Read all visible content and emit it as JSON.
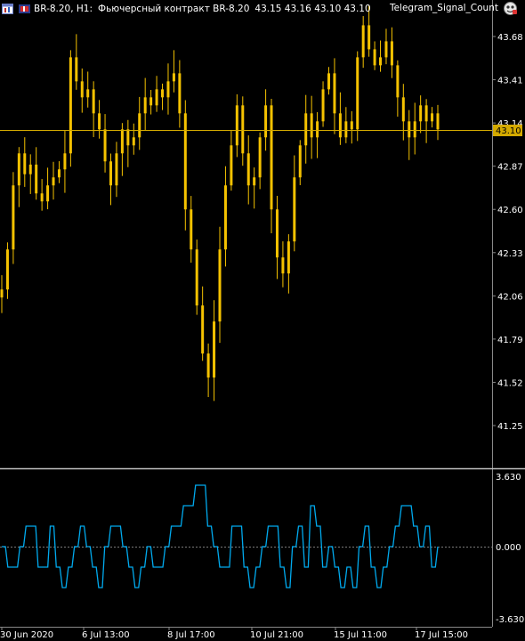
{
  "header": {
    "symbol_period": "BR-8.20, H1:",
    "description": "Фьючерсный контракт BR-8.20",
    "ohlc": "43.15 43.16 43.10 43.10",
    "expert_name": "Telegram_Signal_Count"
  },
  "colors": {
    "background": "#000000",
    "candles": "#f5c200",
    "bid_line": "#d4aa00",
    "indicator": "#00aaee",
    "grid_text": "#ffffff",
    "separator": "#c0c0c0"
  },
  "price_axis": {
    "labels": [
      "43.68",
      "43.41",
      "43.14",
      "42.87",
      "42.60",
      "42.33",
      "42.06",
      "41.79",
      "41.52",
      "41.25"
    ],
    "current_price": "43.10"
  },
  "indicator_axis": {
    "labels": [
      "3.630",
      "0.000",
      "-3.630"
    ]
  },
  "time_axis": {
    "labels": [
      "30 Jun 2020",
      "6 Jul 13:00",
      "8 Jul 17:00",
      "10 Jul 21:00",
      "15 Jul 11:00",
      "17 Jul 15:00"
    ]
  },
  "chart_data": {
    "type": "line",
    "price_series": [
      42.1,
      42.35,
      42.75,
      42.95,
      42.82,
      42.88,
      42.7,
      42.65,
      42.75,
      42.8,
      42.85,
      42.95,
      43.55,
      43.4,
      43.3,
      43.35,
      43.2,
      43.1,
      42.9,
      42.75,
      42.95,
      43.1,
      43.0,
      43.05,
      43.2,
      43.3,
      43.25,
      43.35,
      43.3,
      43.4,
      43.45,
      43.2,
      42.6,
      42.35,
      42.0,
      41.7,
      41.55,
      41.9,
      42.35,
      42.75,
      43.0,
      43.25,
      42.95,
      42.75,
      42.8,
      43.05,
      43.25,
      42.6,
      42.3,
      42.2,
      42.4,
      42.8,
      43.0,
      43.2,
      43.05,
      43.15,
      43.35,
      43.45,
      43.2,
      43.05,
      43.15,
      43.1,
      43.55,
      43.75,
      43.6,
      43.5,
      43.55,
      43.65,
      43.5,
      43.3,
      43.15,
      43.05,
      43.15,
      43.25,
      43.15,
      43.2,
      43.1
    ],
    "indicator_series": [
      0,
      -1,
      -1,
      0,
      1,
      1,
      -1,
      -1,
      1,
      -1,
      -2,
      -1,
      0,
      1,
      0,
      -1,
      -2,
      0,
      1,
      1,
      0,
      -1,
      -2,
      -1,
      0,
      -1,
      -1,
      0,
      1,
      1,
      2,
      2,
      3,
      3,
      1,
      0,
      -1,
      -1,
      1,
      1,
      -1,
      -2,
      -1,
      0,
      1,
      1,
      -1,
      -2,
      0,
      1,
      -1,
      2,
      1,
      -1,
      0,
      -1,
      -2,
      -1,
      -2,
      0,
      1,
      -1,
      -2,
      -1,
      0,
      1,
      2,
      2,
      1,
      0,
      1,
      -1,
      0
    ],
    "ylim_price": [
      41.25,
      43.68
    ],
    "ylim_indicator": [
      -3.63,
      3.63
    ]
  }
}
